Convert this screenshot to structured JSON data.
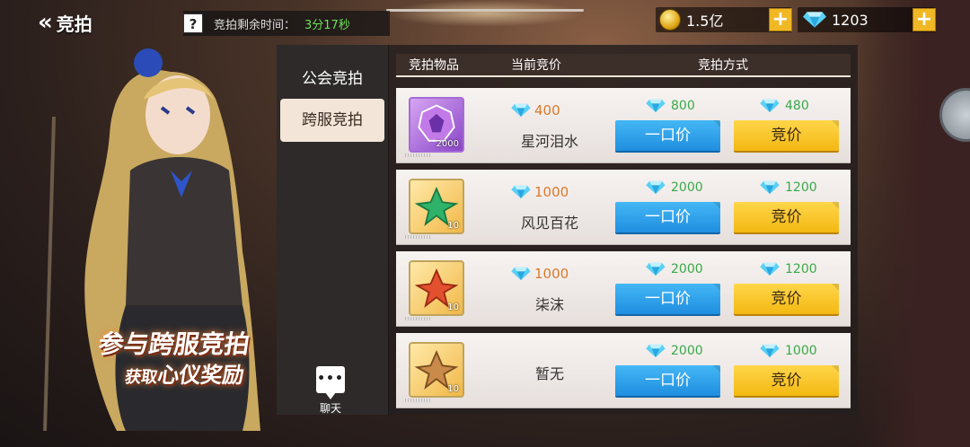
{
  "header": {
    "back_label": "竞拍",
    "help_label": "?",
    "timer_label": "竞拍剩余时间：",
    "timer_value": "3分17秒"
  },
  "currency": {
    "gold_amount": "1.5亿",
    "gem_amount": "1203",
    "plus_label": "+"
  },
  "promo": {
    "line1": "参与跨服竞拍",
    "line2_small": "获取",
    "line2_big": "心仪奖励"
  },
  "tabs": [
    {
      "label": "公会竞拍",
      "active": false
    },
    {
      "label": "跨服竞拍",
      "active": true
    }
  ],
  "chat": {
    "icon_text": "•••",
    "label": "聊天"
  },
  "table": {
    "headers": [
      "竞拍物品",
      "当前竞价",
      "竞拍方式"
    ],
    "buy_now_label": "一口价",
    "bid_label": "竞价",
    "rows": [
      {
        "item_qty": "2000",
        "current_price": "400",
        "name": "星河泪水",
        "buyout_price": "800",
        "bid_price": "480"
      },
      {
        "item_qty": "10",
        "current_price": "1000",
        "name": "风见百花",
        "buyout_price": "2000",
        "bid_price": "1200"
      },
      {
        "item_qty": "10",
        "current_price": "1000",
        "name": "柒沫",
        "buyout_price": "2000",
        "bid_price": "1200"
      },
      {
        "item_qty": "10",
        "current_price": "",
        "name": "暂无",
        "buyout_price": "2000",
        "bid_price": "1000"
      }
    ]
  },
  "colors": {
    "accent_blue": "#1f8ee0",
    "accent_yellow": "#f3b812",
    "timer_green": "#6fe05a",
    "price_orange": "#d97a2b"
  }
}
